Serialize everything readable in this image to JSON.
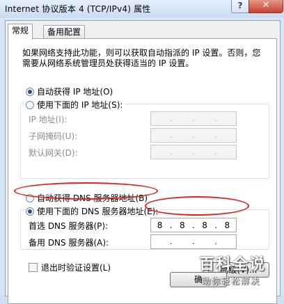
{
  "window": {
    "title": "Internet 协议版本 4 (TCP/IPv4) 属性",
    "help_glyph": "?",
    "close_glyph": "✕"
  },
  "tabs": [
    {
      "label": "常规",
      "active": true
    },
    {
      "label": "备用配置",
      "active": false
    }
  ],
  "description": "如果网络支持此功能，则可以获取自动指派的 IP 设置。否则，您需要从网络系统管理员处获得适当的 IP 设置。",
  "ip_section": {
    "auto_option": "自动获得 IP 地址(O)",
    "manual_option": "使用下面的 IP 地址(S):",
    "auto_selected": true,
    "fields": [
      {
        "label": "IP 地址(I):",
        "octets": [
          ".",
          ".",
          "."
        ]
      },
      {
        "label": "子网掩码(U):",
        "octets": [
          ".",
          ".",
          "."
        ]
      },
      {
        "label": "默认网关(D):",
        "octets": [
          ".",
          ".",
          "."
        ]
      }
    ]
  },
  "dns_section": {
    "auto_option": "自动获得 DNS 服务器地址(B)",
    "manual_option": "使用下面的 DNS 服务器地址(E):",
    "manual_selected": true,
    "preferred_label": "首选 DNS 服务器(P):",
    "preferred_value": [
      "8",
      "8",
      "8",
      "8"
    ],
    "alternate_label": "备用 DNS 服务器(A):",
    "alternate_value": [
      ".",
      ".",
      "."
    ]
  },
  "footer": {
    "validate_checkbox_label": "退出时验证设置(L)",
    "validate_checked": false,
    "advanced_button": "高级(V)...",
    "ok_button": "确"
  },
  "watermark": {
    "main": "百科全说",
    "sub": "助你轻松解决"
  },
  "colors": {
    "annotation": "#e0221c",
    "radio_dot": "#264f8a"
  }
}
